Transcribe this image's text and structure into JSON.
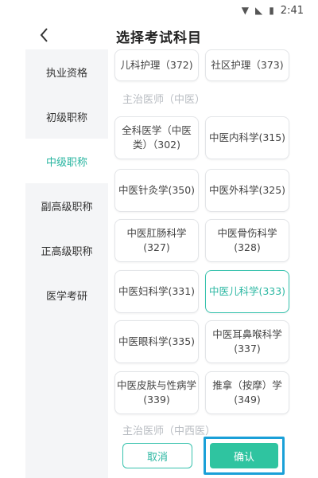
{
  "status_bar": {
    "time": "2:41",
    "wifi_icon": "wifi-icon",
    "signal_icon": "signal-off-icon",
    "battery_icon": "battery-icon"
  },
  "header": {
    "title": "选择考试科目",
    "back_icon": "chevron-left-icon"
  },
  "sidebar": {
    "items": [
      {
        "label": "执业资格"
      },
      {
        "label": "初级职称"
      },
      {
        "label": "中级职称",
        "active": true
      },
      {
        "label": "副高级职称"
      },
      {
        "label": "正高级职称"
      },
      {
        "label": "医学考研"
      }
    ]
  },
  "content": {
    "top_row": [
      {
        "label": "儿科护理（372)"
      },
      {
        "label": "社区护理（373)"
      }
    ],
    "section1_title": "主治医师（中医）",
    "cards": [
      {
        "label": "全科医学（中医类）（302)"
      },
      {
        "label": "中医内科学(315)"
      },
      {
        "label": "中医针灸学(350)"
      },
      {
        "label": "中医外科学(325)"
      },
      {
        "label": "中医肛肠科学(327)"
      },
      {
        "label": "中医骨伤科学(328)"
      },
      {
        "label": "中医妇科学(331)"
      },
      {
        "label": "中医儿科学(333)",
        "selected": true
      },
      {
        "label": "中医眼科学(335)"
      },
      {
        "label": "中医耳鼻喉科学(337)"
      },
      {
        "label": "中医皮肤与性病学(339)"
      },
      {
        "label": "推拿（按摩）学(349)"
      }
    ],
    "section2_title": "主治医师（中西医）"
  },
  "footer": {
    "cancel_label": "取消",
    "confirm_label": "确认"
  },
  "colors": {
    "accent": "#2fc4a0",
    "accent_text": "#2bb7a2",
    "highlight_border": "#1aa0d8",
    "sidebar_bg": "#f4f5f7"
  }
}
